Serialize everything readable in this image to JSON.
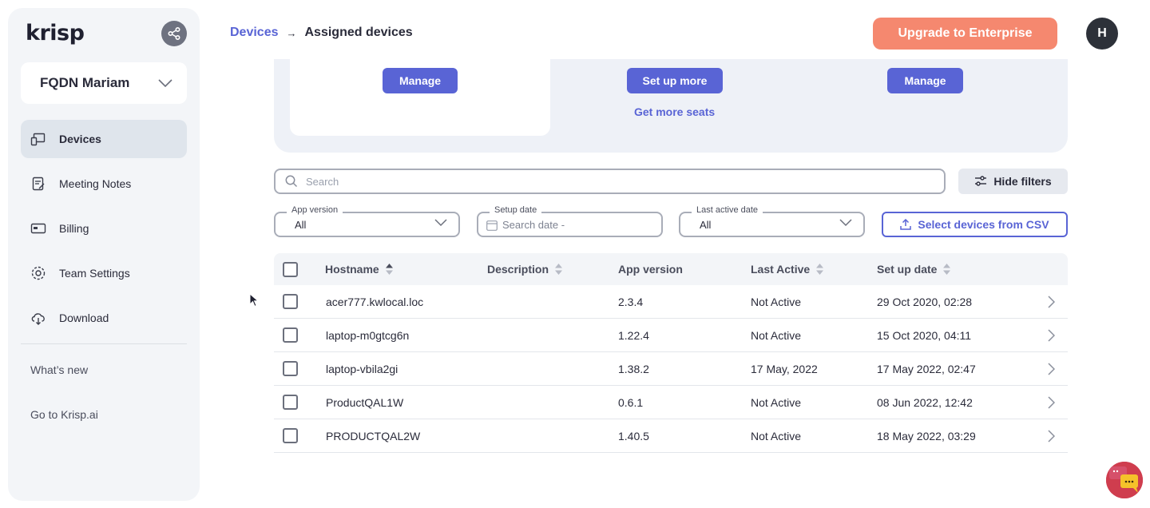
{
  "app": {
    "logo": "krisp"
  },
  "sidebar": {
    "team_name": "FQDN Mariam",
    "items": [
      {
        "label": "Devices",
        "icon": "devices-icon",
        "active": true
      },
      {
        "label": "Meeting Notes",
        "icon": "notes-icon"
      },
      {
        "label": "Billing",
        "icon": "card-icon"
      },
      {
        "label": "Team Settings",
        "icon": "gear-icon"
      },
      {
        "label": "Download",
        "icon": "cloud-download-icon"
      }
    ],
    "links": [
      "What’s new",
      "Go to Krisp.ai"
    ]
  },
  "header": {
    "breadcrumb_parent": "Devices",
    "breadcrumb_sep": "→",
    "breadcrumb_current": "Assigned devices",
    "upgrade_label": "Upgrade to Enterprise",
    "avatar_initial": "H"
  },
  "summary": {
    "manage_left": "Manage",
    "setup_more": "Set up more",
    "get_more_seats": "Get more seats",
    "manage_right": "Manage"
  },
  "filters": {
    "search_placeholder": "Search",
    "hide_filters": "Hide filters",
    "app_version_label": "App version",
    "app_version_value": "All",
    "setup_date_label": "Setup date",
    "setup_date_placeholder": "Search date  -",
    "last_active_label": "Last active date",
    "last_active_value": "All",
    "csv_label": "Select devices from CSV"
  },
  "table": {
    "columns": [
      "Hostname",
      "Description",
      "App version",
      "Last Active",
      "Set up date"
    ],
    "rows": [
      {
        "hostname": "acer777.kwlocal.loc",
        "description": "",
        "app_version": "2.3.4",
        "last_active": "Not Active",
        "setup_date": "29 Oct 2020, 02:28"
      },
      {
        "hostname": "laptop-m0gtcg6n",
        "description": "",
        "app_version": "1.22.4",
        "last_active": "Not Active",
        "setup_date": "15 Oct 2020, 04:11"
      },
      {
        "hostname": "laptop-vbila2gi",
        "description": "",
        "app_version": "1.38.2",
        "last_active": "17 May, 2022",
        "setup_date": "17 May 2022, 02:47"
      },
      {
        "hostname": "ProductQAL1W",
        "description": "",
        "app_version": "0.6.1",
        "last_active": "Not Active",
        "setup_date": "08 Jun 2022, 12:42"
      },
      {
        "hostname": "PRODUCTQAL2W",
        "description": "",
        "app_version": "1.40.5",
        "last_active": "Not Active",
        "setup_date": "18 May 2022, 03:29"
      }
    ]
  },
  "colors": {
    "accent": "#5964d5",
    "upgrade": "#f5886f",
    "sidebar_bg": "#f3f5f8"
  }
}
